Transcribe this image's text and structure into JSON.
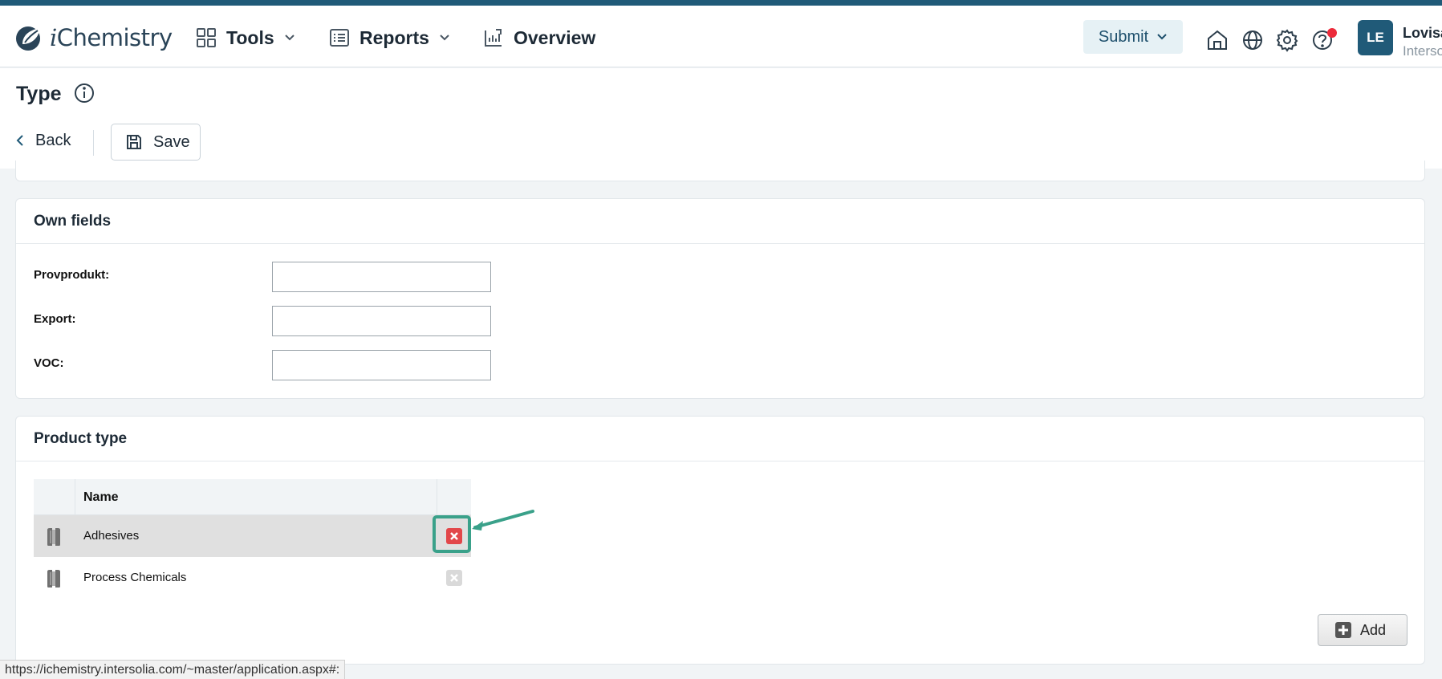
{
  "app": {
    "logo_text": "iChemistry",
    "logo_prefix": "i",
    "logo_rest": "Chemistry"
  },
  "nav": {
    "tools": "Tools",
    "reports": "Reports",
    "overview": "Overview",
    "submit": "Submit"
  },
  "header_icons": [
    "home-icon",
    "globe-icon",
    "settings-icon",
    "help-icon"
  ],
  "user": {
    "initials": "LE",
    "name": "Lovisa",
    "org": "Interso"
  },
  "page": {
    "title": "Type",
    "back_label": "Back",
    "save_label": "Save"
  },
  "own_fields": {
    "title": "Own fields",
    "fields": [
      {
        "label": "Provprodukt:",
        "value": ""
      },
      {
        "label": "Export:",
        "value": ""
      },
      {
        "label": "VOC:",
        "value": ""
      }
    ]
  },
  "product_type": {
    "title": "Product type",
    "column_name": "Name",
    "rows": [
      {
        "name": "Adhesives",
        "selected": true
      },
      {
        "name": "Process Chemicals",
        "selected": false
      }
    ],
    "add_label": "Add"
  },
  "status_url": "https://ichemistry.intersolia.com/~master/application.aspx#:",
  "colors": {
    "brand": "#205a78",
    "highlight": "#3aa18a",
    "delete_active": "#e2474a"
  }
}
